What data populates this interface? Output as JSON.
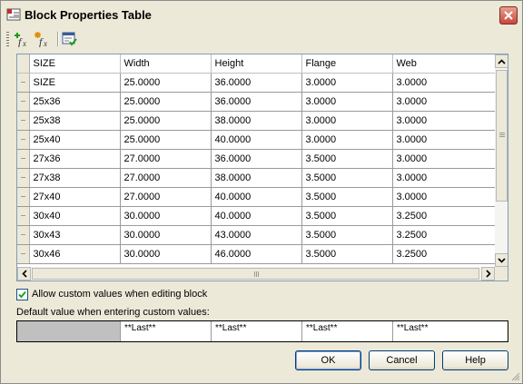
{
  "window": {
    "title": "Block Properties Table"
  },
  "toolbar": {
    "icons": [
      "add-property-icon",
      "new-property-icon",
      "audit-icon"
    ]
  },
  "table": {
    "columns": [
      "SIZE",
      "Width",
      "Height",
      "Flange",
      "Web"
    ],
    "rows": [
      [
        "SIZE",
        "25.0000",
        "36.0000",
        "3.0000",
        "3.0000"
      ],
      [
        "25x36",
        "25.0000",
        "36.0000",
        "3.0000",
        "3.0000"
      ],
      [
        "25x38",
        "25.0000",
        "38.0000",
        "3.0000",
        "3.0000"
      ],
      [
        "25x40",
        "25.0000",
        "40.0000",
        "3.0000",
        "3.0000"
      ],
      [
        "27x36",
        "27.0000",
        "36.0000",
        "3.5000",
        "3.0000"
      ],
      [
        "27x38",
        "27.0000",
        "38.0000",
        "3.5000",
        "3.0000"
      ],
      [
        "27x40",
        "27.0000",
        "40.0000",
        "3.5000",
        "3.0000"
      ],
      [
        "30x40",
        "30.0000",
        "40.0000",
        "3.5000",
        "3.2500"
      ],
      [
        "30x43",
        "30.0000",
        "43.0000",
        "3.5000",
        "3.2500"
      ],
      [
        "30x46",
        "30.0000",
        "46.0000",
        "3.5000",
        "3.2500"
      ]
    ]
  },
  "options": {
    "allow_custom_label": "Allow custom values when editing block",
    "allow_custom_checked": true
  },
  "defaults": {
    "label": "Default value when entering custom values:",
    "values": [
      "",
      "**Last**",
      "**Last**",
      "**Last**",
      "**Last**"
    ]
  },
  "buttons": {
    "ok": "OK",
    "cancel": "Cancel",
    "help": "Help"
  },
  "colors": {
    "accent": "#003c74",
    "close": "#c8473a"
  }
}
